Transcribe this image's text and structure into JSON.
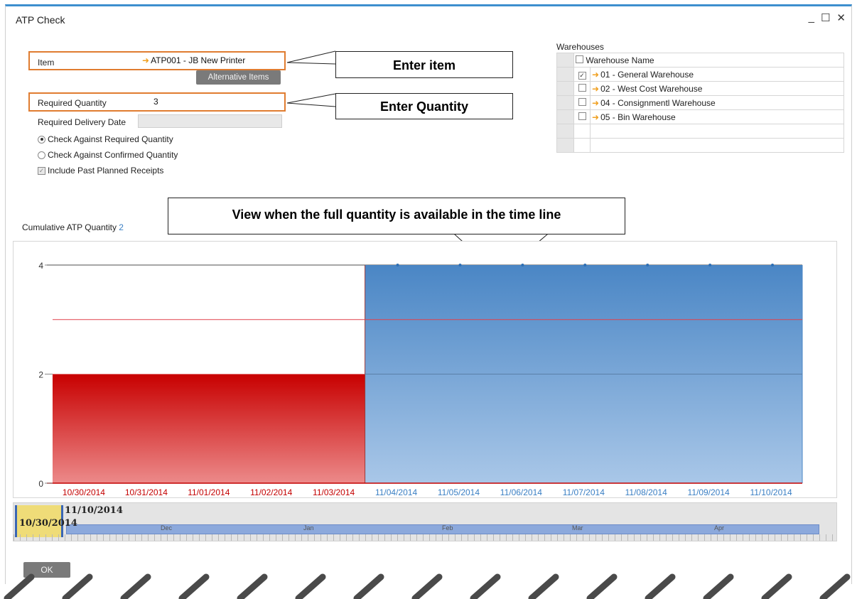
{
  "window": {
    "title": "ATP Check",
    "minimize": "_",
    "maximize": "☐",
    "close": "✕"
  },
  "form": {
    "item_label": "Item",
    "item_value": "ATP001 - JB New Printer",
    "alt_items_button": "Alternative Items",
    "req_qty_label": "Required Quantity",
    "req_qty_value": "3",
    "req_date_label": "Required Delivery Date",
    "radio_required": "Check Against Required Quantity",
    "radio_confirmed": "Check Against Confirmed Quantity",
    "include_past": "Include Past Planned Receipts",
    "radio_selected": "required"
  },
  "callouts": {
    "enter_item": "Enter item",
    "enter_quantity": "Enter Quantity",
    "timeline_note": "View when the full quantity is available in the time line"
  },
  "warehouses": {
    "label": "Warehouses",
    "header": "Warehouse Name",
    "rows": [
      {
        "name": "01 - General Warehouse",
        "checked": true
      },
      {
        "name": "02 - West Cost Warehouse",
        "checked": false
      },
      {
        "name": "04 - Consignmentl Warehouse",
        "checked": false
      },
      {
        "name": "05 - Bin Warehouse",
        "checked": false
      }
    ]
  },
  "cumulative": {
    "label": "Cumulative ATP Quantity",
    "value": "2"
  },
  "chart_data": {
    "type": "bar",
    "categories": [
      "10/30/2014",
      "10/31/2014",
      "11/01/2014",
      "11/02/2014",
      "11/03/2014",
      "11/04/2014",
      "11/05/2014",
      "11/06/2014",
      "11/07/2014",
      "11/08/2014",
      "11/09/2014",
      "11/10/2014"
    ],
    "series": [
      {
        "values": [
          2,
          2,
          2,
          2,
          2,
          4,
          4,
          4,
          4,
          4,
          4,
          4
        ]
      }
    ],
    "bar_colors": [
      "#c40000",
      "#c40000",
      "#c40000",
      "#c40000",
      "#c40000",
      "#4a86c5",
      "#4a86c5",
      "#4a86c5",
      "#4a86c5",
      "#4a86c5",
      "#4a86c5",
      "#4a86c5"
    ],
    "required_line": 3,
    "required_line_color": "#e0404a",
    "ylim": [
      0,
      4
    ],
    "yticks": [
      "0",
      "2",
      "4"
    ],
    "category_label_colors": {
      "before": "#c40000",
      "after": "#3a7fc4"
    },
    "grid": true
  },
  "timeline": {
    "end_date": "11/10/2014",
    "start_date": "10/30/2014",
    "months": [
      "Dec",
      "Jan",
      "Feb",
      "Mar",
      "Apr"
    ]
  },
  "buttons": {
    "ok": "OK"
  }
}
